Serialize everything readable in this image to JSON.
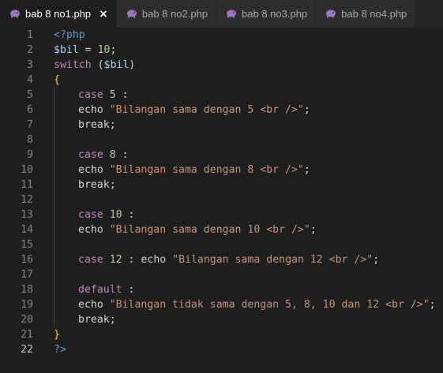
{
  "tabs": [
    {
      "label": "bab 8 no1.php",
      "active": true,
      "close": "×"
    },
    {
      "label": "bab 8 no2.php",
      "active": false
    },
    {
      "label": "bab 8 no3.php",
      "active": false
    },
    {
      "label": "bab 8 no4.php",
      "active": false
    }
  ],
  "lines": [
    {
      "n": "1"
    },
    {
      "n": "2"
    },
    {
      "n": "3"
    },
    {
      "n": "4"
    },
    {
      "n": "5"
    },
    {
      "n": "6"
    },
    {
      "n": "7"
    },
    {
      "n": "8"
    },
    {
      "n": "9"
    },
    {
      "n": "10"
    },
    {
      "n": "11"
    },
    {
      "n": "12"
    },
    {
      "n": "13"
    },
    {
      "n": "14"
    },
    {
      "n": "15"
    },
    {
      "n": "16"
    },
    {
      "n": "17"
    },
    {
      "n": "18"
    },
    {
      "n": "19"
    },
    {
      "n": "20"
    },
    {
      "n": "21"
    },
    {
      "n": "22"
    }
  ],
  "code": {
    "l1_open": "<?php",
    "l2_var": "$bil",
    "l2_eq": " = ",
    "l2_num": "10",
    "l2_semi": ";",
    "l3_switch": "switch",
    "l3_open": " (",
    "l3_var": "$bil",
    "l3_close": ")",
    "l4_brace": "{",
    "case": "case",
    "echo": "echo",
    "break": "break",
    "default": "default",
    "colon": " :",
    "semi": ";",
    "l5_num": "5",
    "l6_str": "\"Bilangan sama dengan 5 <br />\"",
    "l9_num": "8",
    "l10_str": "\"Bilangan sama dengan 8 <br />\"",
    "l13_num": "10",
    "l14_str": "\"Bilangan sama dengan 10 <br />\"",
    "l16_num": "12",
    "l16_mid": " : ",
    "l16_str": "\"Bilangan sama dengan 12 <br />\"",
    "l19_str": "\"Bilangan tidak sama dengan 5, 8, 10 dan 12 <br />\"",
    "l21_brace": "}",
    "l22_close": "?>"
  },
  "colors": {
    "background": "#1e1e1e",
    "keyword": "#c586c0",
    "tag": "#569cd6",
    "variable": "#9cdcfe",
    "number": "#b5cea8",
    "string": "#ce9178"
  },
  "icons": {
    "tab_icon": "php-elephant-icon",
    "close_icon": "close-icon"
  }
}
